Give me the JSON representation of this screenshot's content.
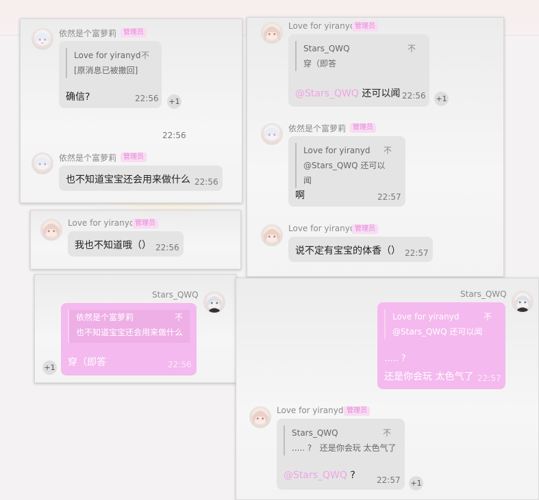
{
  "colors": {
    "pink_bubble": "#f4b9ee",
    "mention": "#f0a3e4",
    "badge_text": "#e58ad6",
    "badge_bg": "#f8dcf3",
    "gray_bubble": "#e4e4e4"
  },
  "icons": {
    "avatar_yiranyd": "anime-girl-avatar",
    "avatar_fuluoli": "white-hair-girl-avatar",
    "avatar_stars": "dark-hair-avatar"
  },
  "badge": "管理员",
  "plus_one": "+1",
  "p1": {
    "m1": {
      "name": "依然是个富萝莉",
      "quote_name": "Love for yiranyd",
      "quote_x": "不",
      "quote_text": "[原消息已被撤回]",
      "text": "确信?",
      "time": "22:56"
    },
    "loose_time": "22:56",
    "m2": {
      "name": "依然是个富萝莉",
      "text": "也不知道宝宝还会用来做什么",
      "time": "22:56"
    }
  },
  "p2": {
    "m1": {
      "name": "Love for yiranyd",
      "quote_name": "Stars_QWQ",
      "quote_x": "不",
      "quote_text": "穿（即答",
      "mention": "@Stars_QWQ",
      "text": " 还可以闻",
      "time": "22:56"
    },
    "m2": {
      "name": "依然是个富萝莉",
      "quote_name": "Love for yiranyd",
      "quote_x": "不",
      "quote_text": "@Stars_QWQ 还可以闻",
      "text": "啊",
      "time": "22:57"
    },
    "m3": {
      "name": "Love for yiranyd",
      "text": "说不定有宝宝的体香（）",
      "time": "22:57"
    }
  },
  "p3": {
    "m1": {
      "name": "Love for yiranyd",
      "text": "我也不知道哦（）",
      "time": "22:56"
    }
  },
  "p4": {
    "m1": {
      "name": "Stars_QWQ",
      "quote_name": "依然是个富萝莉",
      "quote_x": "不",
      "quote_text": "也不知道宝宝还会用来做什么",
      "text": "穿（即答",
      "time": "22:56"
    }
  },
  "p5": {
    "m1": {
      "name": "Stars_QWQ",
      "quote_name": "Love for yiranyd",
      "quote_x": "不",
      "quote_text": "@Stars_QWQ 还可以闻",
      "line1": "..... ?",
      "line2": "还是你会玩 太色气了",
      "time": "22:57"
    },
    "m2": {
      "name": "Love for yiranyd",
      "quote_name": "Stars_QWQ",
      "quote_x": "不",
      "quote_text": "..... ?   还是你会玩 太色气了",
      "mention": "@Stars_QWQ",
      "text": " ?",
      "time": "22:57"
    }
  }
}
